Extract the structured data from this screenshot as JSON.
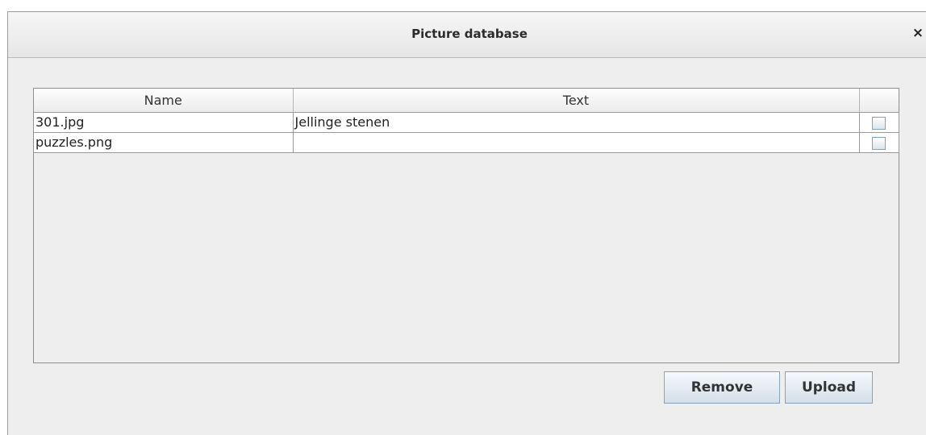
{
  "dialog": {
    "title": "Picture database",
    "close_label": "×"
  },
  "table": {
    "columns": [
      "Name",
      "Text",
      ""
    ],
    "rows": [
      {
        "name": "301.jpg",
        "text": "Jellinge stenen",
        "checked": false
      },
      {
        "name": "puzzles.png",
        "text": "",
        "checked": false
      }
    ]
  },
  "buttons": {
    "remove": "Remove",
    "upload": "Upload"
  }
}
